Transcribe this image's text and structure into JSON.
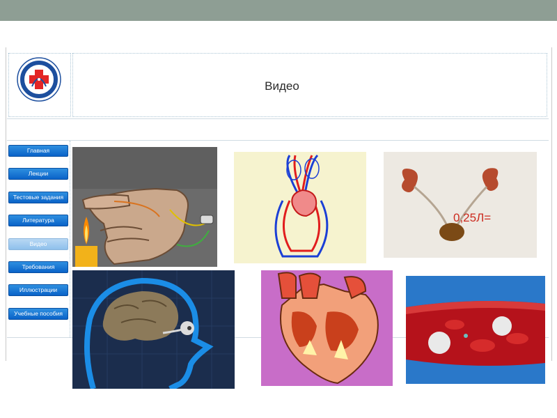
{
  "header": {
    "title": "Видео"
  },
  "nav": {
    "items": [
      {
        "label": "Главная"
      },
      {
        "label": "Лекции"
      },
      {
        "label": "Тестовые задания"
      },
      {
        "label": "Литература"
      },
      {
        "label": "Видео",
        "active": true
      },
      {
        "label": "Требования"
      },
      {
        "label": "Иллюстрации"
      },
      {
        "label": "Учебные пособия"
      }
    ]
  },
  "videos": [
    {
      "icon": "hand-reflex-candle-thumbnail"
    },
    {
      "icon": "circulation-diagram-thumbnail"
    },
    {
      "icon": "kidneys-bladder-thumbnail",
      "overlay_text": "0,25Л="
    },
    {
      "icon": "brain-eye-thumbnail"
    },
    {
      "icon": "heart-cross-section-thumbnail"
    },
    {
      "icon": "blood-vessel-cells-thumbnail"
    }
  ],
  "colors": {
    "top_bar": "#8e9e94",
    "nav_button": "#1a77d6",
    "nav_button_active": "#a6cdf0"
  }
}
